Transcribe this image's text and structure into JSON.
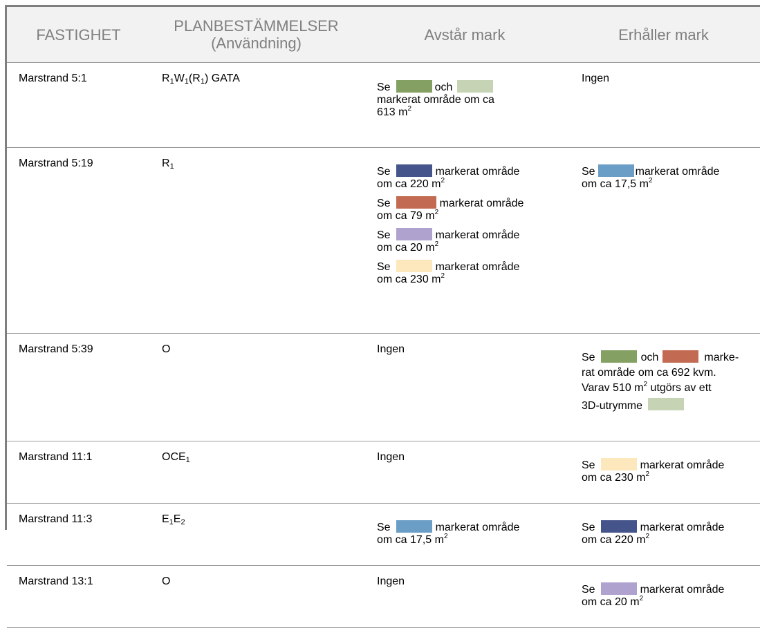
{
  "headers": {
    "fastighet": "FASTIGHET",
    "plan_line1": "PLANBESTÄMMELSER",
    "plan_line2": "(Användning)",
    "avstar": "Avstår mark",
    "erhaller": "Erhåller mark"
  },
  "colors": {
    "green": "#84a062",
    "light_green": "#c6d3b5",
    "navy": "#45548a",
    "rust": "#c26b52",
    "lavender": "#b0a2cf",
    "cream": "#fde8bd",
    "light_blue": "#6a9ec6"
  },
  "rows": [
    {
      "fastighet": "Marstrand 5:1",
      "plan": {
        "a": "R",
        "b": "1",
        "c": "W",
        "d": "1",
        "e": "(R",
        "f": "1",
        "g": ") GATA"
      },
      "avstar": {
        "se": "Se",
        "och": "och",
        "rest": "markerat område om ca",
        "val": "613 m",
        "sup": "2"
      },
      "erhaller": "Ingen"
    },
    {
      "fastighet": "Marstrand 5:19",
      "plan": {
        "a": "R",
        "b": "1"
      },
      "avstar": [
        {
          "se": "Se",
          "t1": "markerat område",
          "t2": "om ca 220 m",
          "sup": "2"
        },
        {
          "se": "Se",
          "t1": "markerat område",
          "t2": "om ca 79 m",
          "sup": "2"
        },
        {
          "se": "Se",
          "t1": "markerat område",
          "t2": "om ca 20 m",
          "sup": "2"
        },
        {
          "se": "Se",
          "t1": "markerat område",
          "t2": "om ca 230 m",
          "sup": "2"
        }
      ],
      "erhaller": {
        "se": "Se",
        "t1": "markerat område",
        "t2": "om ca 17,5 m",
        "sup": "2"
      }
    },
    {
      "fastighet": "Marstrand 5:39",
      "plan": "O",
      "avstar": "Ingen",
      "erhaller": {
        "se": "Se",
        "och": "och",
        "marke": "marke-",
        "line2": "rat område om ca 692 kvm.",
        "line3a": "Varav 510 m",
        "sup": "2",
        "line3b": " utgörs av ett",
        "line4": "3D-utrymme"
      }
    },
    {
      "fastighet": "Marstrand 11:1",
      "plan": {
        "a": "OCE",
        "b": "1"
      },
      "avstar": "Ingen",
      "erhaller": {
        "se": "Se",
        "t1": "markerat område",
        "t2": "om ca 230 m",
        "sup": "2"
      }
    },
    {
      "fastighet": "Marstrand 11:3",
      "plan": {
        "a": "E",
        "b": "1",
        "c": "E",
        "d": "2"
      },
      "avstar": {
        "se": "Se",
        "t1": "markerat område",
        "t2": "om ca 17,5 m",
        "sup": "2"
      },
      "erhaller": {
        "se": "Se",
        "t1": "markerat område",
        "t2": "om ca 220 m",
        "sup": "2"
      }
    },
    {
      "fastighet": "Marstrand 13:1",
      "plan": "O",
      "avstar": "Ingen",
      "erhaller": {
        "se": "Se",
        "t1": "markerat område",
        "t2": "om ca 20 m",
        "sup": "2"
      }
    }
  ]
}
